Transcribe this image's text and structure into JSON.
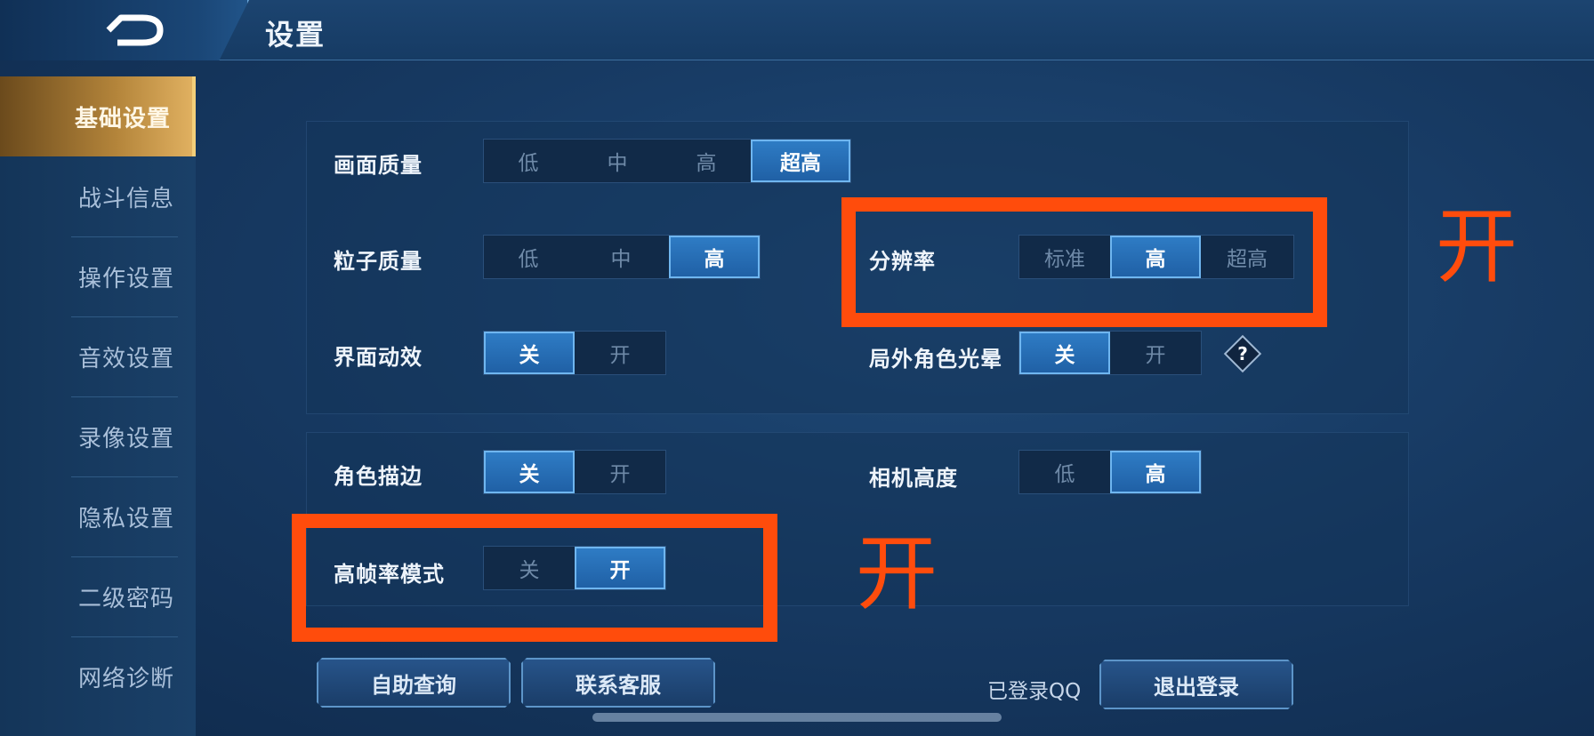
{
  "header": {
    "title": "设置",
    "back_icon": "back-arrow-icon"
  },
  "sidebar": {
    "items": [
      {
        "label": "基础设置",
        "active": true
      },
      {
        "label": "战斗信息",
        "active": false
      },
      {
        "label": "操作设置",
        "active": false
      },
      {
        "label": "音效设置",
        "active": false
      },
      {
        "label": "录像设置",
        "active": false
      },
      {
        "label": "隐私设置",
        "active": false
      },
      {
        "label": "二级密码",
        "active": false
      },
      {
        "label": "网络诊断",
        "active": false
      }
    ]
  },
  "settings": {
    "picture_quality": {
      "label": "画面质量",
      "options": [
        "低",
        "中",
        "高",
        "超高"
      ],
      "selected": "超高"
    },
    "particle_quality": {
      "label": "粒子质量",
      "options": [
        "低",
        "中",
        "高"
      ],
      "selected": "高"
    },
    "resolution": {
      "label": "分辨率",
      "options": [
        "标准",
        "高",
        "超高"
      ],
      "selected": "高"
    },
    "ui_animation": {
      "label": "界面动效",
      "options": [
        "关",
        "开"
      ],
      "selected": "关"
    },
    "hero_glow": {
      "label": "局外角色光晕",
      "options": [
        "关",
        "开"
      ],
      "selected": "关",
      "help": "?"
    },
    "outline": {
      "label": "角色描边",
      "options": [
        "关",
        "开"
      ],
      "selected": "关"
    },
    "camera_height": {
      "label": "相机高度",
      "options": [
        "低",
        "高"
      ],
      "selected": "高"
    },
    "high_fps": {
      "label": "高帧率模式",
      "options": [
        "关",
        "开"
      ],
      "selected": "开"
    }
  },
  "annotations": {
    "note_resolution": "开",
    "note_fps": "开",
    "color": "#ff4c0c"
  },
  "footer": {
    "self_service": "自助查询",
    "contact_support": "联系客服",
    "login_status": "已登录QQ",
    "logout": "退出登录"
  }
}
